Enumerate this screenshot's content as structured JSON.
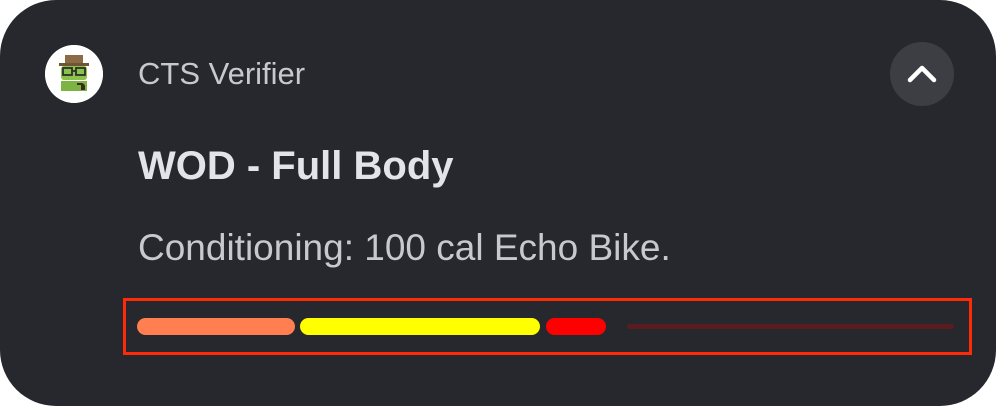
{
  "notification": {
    "app_name": "CTS Verifier",
    "title": "WOD - Full Body",
    "text": "Conditioning: 100 cal Echo Bike.",
    "app_icon": "cts-verifier-robot-icon",
    "expand_icon": "chevron-up-icon"
  },
  "progress": {
    "segments": [
      {
        "color": "#ff7f50",
        "fraction": 0.2
      },
      {
        "color": "#ffff00",
        "fraction": 0.3
      },
      {
        "color": "#ff0000",
        "fraction": 0.08
      }
    ],
    "track_color": "#5a1d1f",
    "highlight_color": "#ff2a0a"
  },
  "colors": {
    "background": "#26282d",
    "text_primary": "#e3e4e7",
    "text_secondary": "#c7c9cd"
  }
}
